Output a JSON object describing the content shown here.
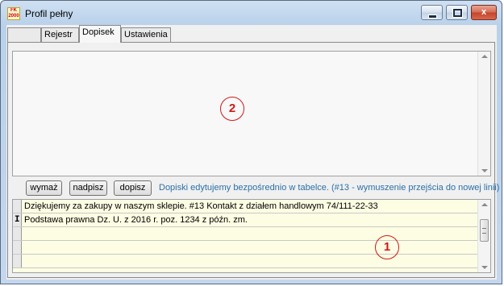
{
  "window": {
    "title": "Profil pełny",
    "app_icon_text": "FK 2000",
    "controls": {
      "close_glyph": "x"
    }
  },
  "tabs": [
    {
      "label": ""
    },
    {
      "label": "Rejestr"
    },
    {
      "label": "Dopisek",
      "active": true
    },
    {
      "label": "Ustawienia"
    }
  ],
  "memo": {
    "value": "",
    "marker": "2"
  },
  "buttons": {
    "delete": "wymaż",
    "overwrite": "nadpisz",
    "append": "dopisz"
  },
  "hint": "Dopiski edytujemy bezpośrednio w tabelce. (#13 - wymuszenie przejścia do nowej linii)",
  "grid": {
    "marker": "1",
    "cursor_glyph": "I",
    "rows": [
      {
        "text": "Dziękujemy za zakupy w naszym sklepie. #13 Kontakt z działem handlowym 74/111-22-33"
      },
      {
        "text": "Podstawa prawna Dz. U. z 2016 r. poz. 1234 z późn. zm.",
        "current": true
      },
      {
        "text": ""
      },
      {
        "text": ""
      },
      {
        "text": ""
      }
    ]
  },
  "colors": {
    "hint": "#2a6fa8",
    "marker": "#d01818",
    "grid_background": "#fdfde3"
  }
}
